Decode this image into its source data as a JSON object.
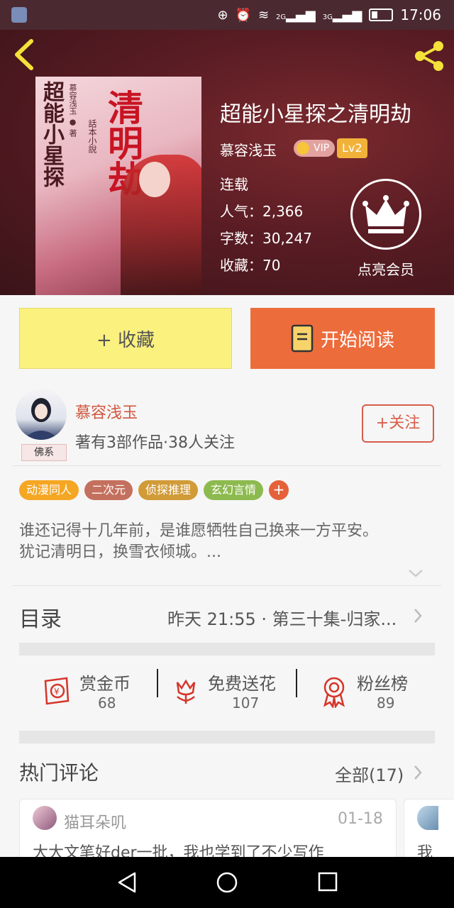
{
  "status_bar": {
    "time": "17:06",
    "net1": "2G",
    "net2": "3G"
  },
  "book": {
    "title": "超能小星探之清明劫",
    "author": "慕容浅玉",
    "vip_label": "VIP",
    "level": "Lv2",
    "status": "连载",
    "popularity_label": "人气：",
    "popularity": "2,366",
    "words_label": "字数：",
    "words": "30,247",
    "favorites_label": "收藏：",
    "favorites": "70",
    "cover": {
      "title": "清明劫",
      "subtitle": "超能小星探",
      "author": "慕容浅玉 ● 著",
      "tag": "話本小說"
    }
  },
  "member": {
    "label": "点亮会员"
  },
  "actions": {
    "collect": "+ 收藏",
    "read": "开始阅读"
  },
  "author": {
    "name": "慕容浅玉",
    "meta": "著有3部作品·38人关注",
    "badge": "佛系",
    "follow": "+关注"
  },
  "tags": [
    {
      "label": "动漫同人",
      "color": "#f5a623"
    },
    {
      "label": "二次元",
      "color": "#c4705e"
    },
    {
      "label": "侦探推理",
      "color": "#d19b38"
    },
    {
      "label": "玄幻言情",
      "color": "#8dba4f"
    }
  ],
  "tag_add": "+",
  "description": {
    "line1": "谁还记得十几年前，是谁愿牺牲自己换来一方平安。",
    "line2": "犹记清明日，换雪衣倾城。..."
  },
  "toc": {
    "label": "目录",
    "latest": "昨天 21:55 · 第三十集-归家..."
  },
  "stats": [
    {
      "label": "赏金币",
      "value": "68",
      "icon": "reward-envelope-icon"
    },
    {
      "label": "免费送花",
      "value": "107",
      "icon": "flower-icon"
    },
    {
      "label": "粉丝榜",
      "value": "89",
      "icon": "medal-icon"
    }
  ],
  "comments": {
    "label": "热门评论",
    "all": "全部(17)",
    "items": [
      {
        "user": "猫耳朵叽",
        "date": "01-18",
        "text": "大大文笔好der一批，我也学到了不少写作"
      },
      {
        "text": "我"
      }
    ]
  },
  "colors": {
    "accent": "#ec6c3c",
    "collect": "#fbf17f",
    "author_name": "#d0573f"
  }
}
